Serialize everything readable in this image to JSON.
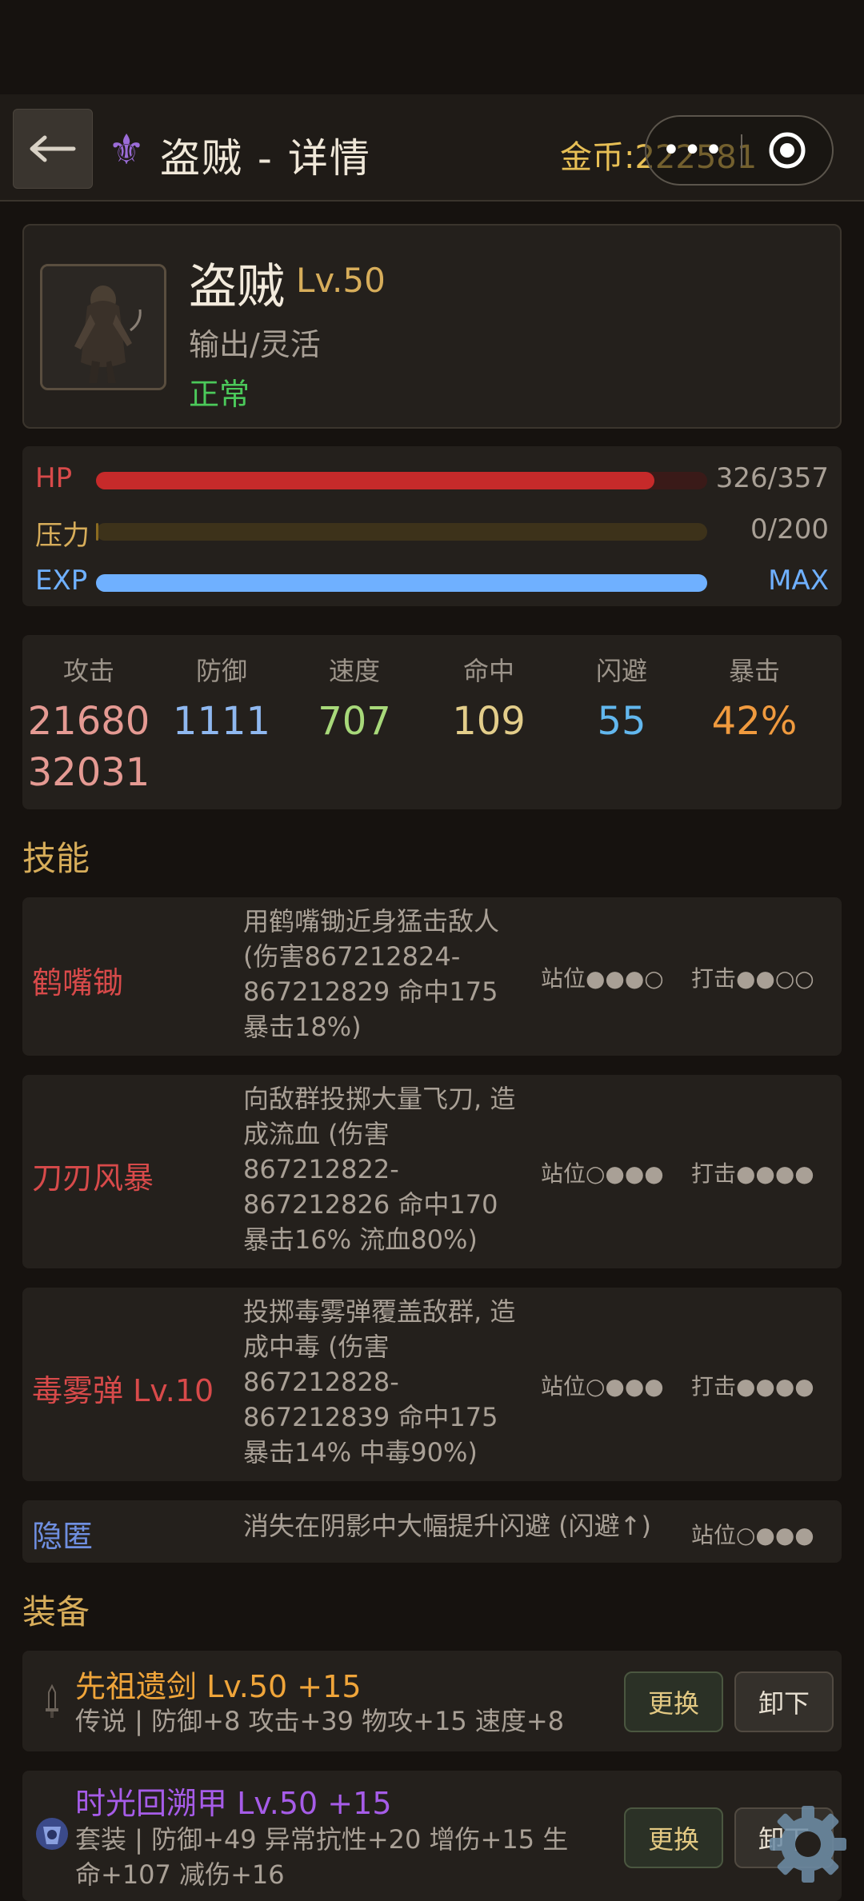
{
  "header": {
    "title": "盗贼 - 详情",
    "gold_label": "金币:222581",
    "capsule_dots": "•••",
    "class_icon": "fleur-de-lis-icon"
  },
  "hero": {
    "name": "盗贼",
    "level": "Lv.50",
    "role": "输出/灵活",
    "status": "正常"
  },
  "bars": {
    "hp": {
      "label": "HP",
      "value": "326/357",
      "fraction": 0.913,
      "color": "#c62a2a",
      "track": "#3a1a18",
      "label_color": "#d84a4a"
    },
    "stress": {
      "label": "压力",
      "value": "0/200",
      "fraction": 0.0,
      "color": "#8a6a20",
      "track": "#3d321a",
      "label_color": "#d7ad5a"
    },
    "exp": {
      "label": "EXP",
      "value": "MAX",
      "fraction": 1.0,
      "color": "#6fb0ff",
      "track": "#1f2f44",
      "label_color": "#6fb0ff"
    }
  },
  "stats": [
    {
      "label": "攻击",
      "value": "21680\n32031",
      "color": "#e59a93"
    },
    {
      "label": "防御",
      "value": "1111",
      "color": "#8fb8f0"
    },
    {
      "label": "速度",
      "value": "707",
      "color": "#a8d97a"
    },
    {
      "label": "命中",
      "value": "109",
      "color": "#e3cd8a"
    },
    {
      "label": "闪避",
      "value": "55",
      "color": "#62b7ee"
    },
    {
      "label": "暴击",
      "value": "42%",
      "color": "#f09a3e"
    }
  ],
  "skills_title": "技能",
  "skills": [
    {
      "name": "鹤嘴锄",
      "desc": "用鹤嘴锄近身猛击敌人 (伤害867212824-867212829 命中175 暴击18%)",
      "pos": "站位●●●○",
      "hit": "打击●●○○"
    },
    {
      "name": "刀刃风暴",
      "desc": "向敌群投掷大量飞刀, 造成流血 (伤害867212822-867212826 命中170 暴击16% 流血80%)",
      "pos": "站位○●●●",
      "hit": "打击●●●●"
    },
    {
      "name": "毒雾弹 Lv.10",
      "desc": "投掷毒雾弹覆盖敌群, 造成中毒 (伤害867212828-867212839 命中175 暴击14% 中毒90%)",
      "pos": "站位○●●●",
      "hit": "打击●●●●"
    },
    {
      "name": "隐匿",
      "desc": "消失在阴影中大幅提升闪避 (闪避↑)",
      "pos": "站位○●●●",
      "hit": ""
    }
  ],
  "equip_title": "装备",
  "equipment": [
    {
      "name": "先祖遗剑 Lv.50 +15",
      "desc": "传说 | 防御+8 攻击+39 物攻+15 速度+8",
      "name_color": "#f0a53a",
      "icon": "sword-icon",
      "swap": "更换",
      "unequip": "卸下"
    },
    {
      "name": "时光回溯甲 Lv.50 +15",
      "desc": "套装 | 防御+49 异常抗性+20 增伤+15 生命+107 减伤+16",
      "name_color": "#a65ce8",
      "icon": "armor-icon",
      "swap": "更换",
      "unequip": "卸下"
    }
  ]
}
